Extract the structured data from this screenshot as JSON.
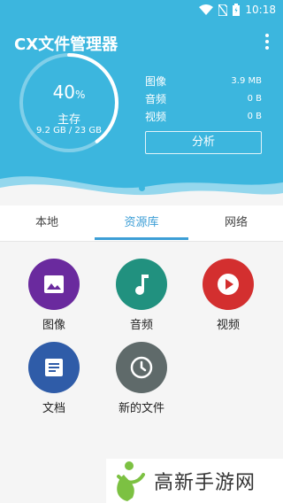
{
  "status_bar": {
    "time": "10:18"
  },
  "header": {
    "title": "CX文件管理器"
  },
  "storage": {
    "percent": "40",
    "percent_sign": "%",
    "percent_value": 40,
    "label": "主存",
    "usage": "9.2 GB / 23 GB"
  },
  "stats": [
    {
      "label": "图像",
      "value": "3.9 MB"
    },
    {
      "label": "音频",
      "value": "0 B"
    },
    {
      "label": "视频",
      "value": "0 B"
    }
  ],
  "analyze_label": "分析",
  "tabs": [
    {
      "label": "本地",
      "active": false
    },
    {
      "label": "资源库",
      "active": true
    },
    {
      "label": "网络",
      "active": false
    }
  ],
  "library": {
    "items": [
      {
        "label": "图像",
        "icon": "image-icon",
        "color": "#6a2a9e"
      },
      {
        "label": "音频",
        "icon": "music-note-icon",
        "color": "#21917f"
      },
      {
        "label": "视频",
        "icon": "play-icon",
        "color": "#d32f2f"
      },
      {
        "label": "文档",
        "icon": "document-icon",
        "color": "#2f5ca8"
      },
      {
        "label": "新的文件",
        "icon": "clock-icon",
        "color": "#5f6a6a"
      }
    ]
  },
  "watermark": {
    "text": "高新手游网"
  },
  "colors": {
    "header": "#3cb6de",
    "accent": "#3c9ed6"
  }
}
